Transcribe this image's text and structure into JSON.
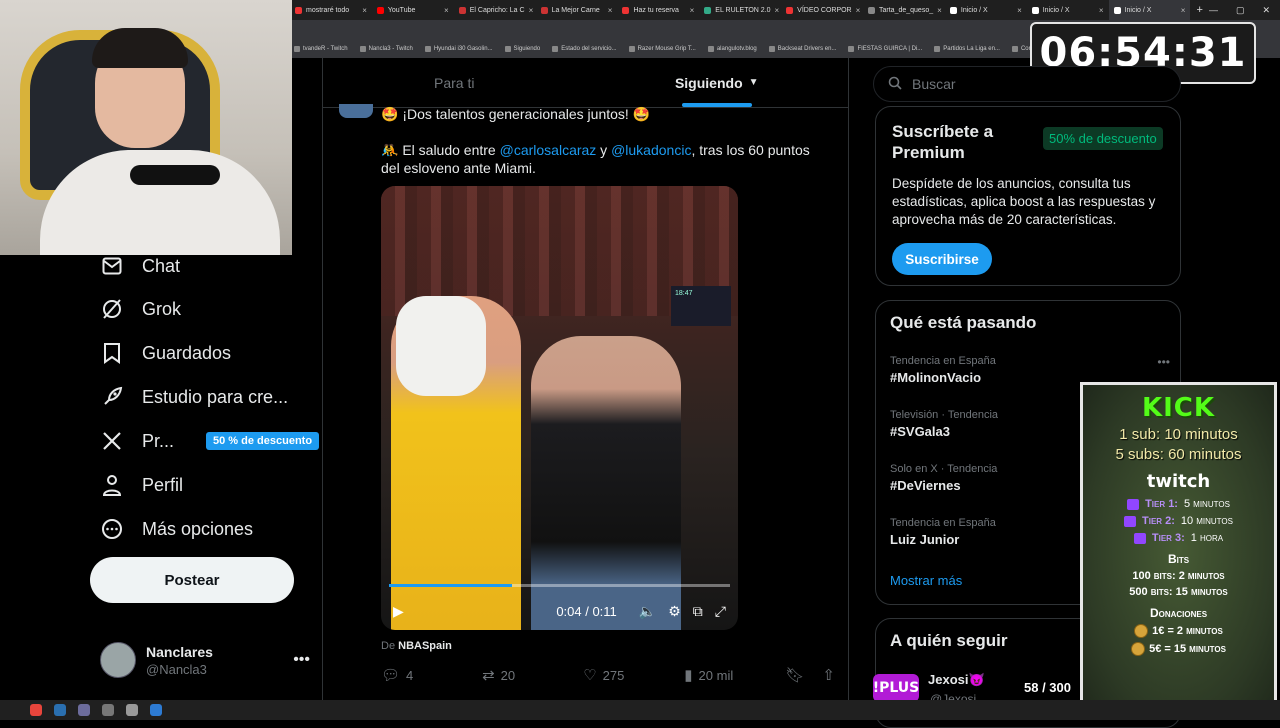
{
  "browser": {
    "tabs": [
      {
        "title": "mostraré todo",
        "color": "#e33"
      },
      {
        "title": "YouTube",
        "color": "#f00"
      },
      {
        "title": "El Capricho: La C",
        "color": "#c33"
      },
      {
        "title": "La Mejor Carne",
        "color": "#c33"
      },
      {
        "title": "Haz tu reserva",
        "color": "#e33"
      },
      {
        "title": "EL RULETON 2.0",
        "color": "#3a8"
      },
      {
        "title": "VÍDEO CORPOR",
        "color": "#e33"
      },
      {
        "title": "Tarta_de_queso_",
        "color": "#888"
      },
      {
        "title": "Inicio / X",
        "color": "#fff"
      },
      {
        "title": "Inicio / X",
        "color": "#fff"
      },
      {
        "title": "Inicio / X",
        "color": "#fff"
      }
    ],
    "bookmarks": [
      "tvandeR - Twitch",
      "Nancla3 - Twitch",
      "Hyundai i30 Gasolin...",
      "Siguiendo",
      "Estado del servicio...",
      "Razer Mouse Grip T...",
      "alangulotv.blog",
      "Backseat Drivers en...",
      "FIESTAS GUIRCA | Di...",
      "Partidos La Liga en...",
      "Concesion..."
    ]
  },
  "timer": "06:54:31",
  "nav": {
    "items": [
      {
        "label": "Chat",
        "icon": "mail-icon"
      },
      {
        "label": "Grok",
        "icon": "grok-icon"
      },
      {
        "label": "Guardados",
        "icon": "bookmark-icon"
      },
      {
        "label": "Estudio para cre...",
        "icon": "rocket-icon"
      },
      {
        "label": "Pr...",
        "icon": "x-logo-icon",
        "badge": "50 % de descuento"
      },
      {
        "label": "Perfil",
        "icon": "person-icon"
      },
      {
        "label": "Más opciones",
        "icon": "more-circle-icon"
      }
    ],
    "post_button": "Postear",
    "user": {
      "name": "Nanclares",
      "handle": "@Nancla3"
    }
  },
  "feed": {
    "tabs": [
      "Para ti",
      "Siguiendo"
    ],
    "post": {
      "title": "🤩 ¡Dos talentos generacionales juntos! 🤩",
      "body_prefix": "🤼 El saludo entre ",
      "mention1": "@carlosalcaraz",
      "mid": " y ",
      "mention2": "@lukadoncic",
      "body_suffix": ", tras los 60 puntos del esloveno ante Miami.",
      "video_time": "0:04 / 0:11",
      "video_progress": 0.36,
      "scoreboard": "18:47",
      "credit_prefix": "De",
      "credit_source": "NBASpain",
      "replies": "4",
      "reposts": "20",
      "likes": "275",
      "views": "20 mil"
    }
  },
  "right": {
    "search_placeholder": "Buscar",
    "premium": {
      "title": "Suscríbete a Premium",
      "badge": "50% de descuento",
      "desc": "Despídete de los anuncios, consulta tus estadísticas, aplica boost a las respuestas y aprovecha más de 20 características.",
      "button": "Suscribirse"
    },
    "trends": {
      "title": "Qué está pasando",
      "items": [
        {
          "context": "Tendencia en España",
          "name": "#MolinonVacio"
        },
        {
          "context": "Televisión · Tendencia",
          "name": "#SVGala3"
        },
        {
          "context": "Solo en X · Tendencia",
          "name": "#DeViernes"
        },
        {
          "context": "Tendencia en España",
          "name": "Luiz Junior"
        }
      ],
      "show_more": "Mostrar más"
    },
    "follow": {
      "title": "A quién seguir",
      "user": "Jexosi😈",
      "handle": "@Jexosi"
    }
  },
  "overlay": {
    "kick_title": "KICK",
    "kick_lines": [
      "1 sub: 10 minutos",
      "5 subs: 60 minutos"
    ],
    "twitch_title": "twitch",
    "tiers": [
      {
        "label": "Tier 1:",
        "value": "5 minutos"
      },
      {
        "label": "Tier 2:",
        "value": "10 minutos"
      },
      {
        "label": "Tier 3:",
        "value": "1 hora"
      }
    ],
    "bits_title": "Bits",
    "bits": [
      "100 bits: 2 minutos",
      "500 bits: 15 minutos"
    ],
    "donations_title": "Donaciones",
    "donations": [
      "1€ = 2 minutos",
      "5€ = 15 minutos"
    ],
    "plus_badge": "!PLUS",
    "counter": "58 / 300"
  }
}
